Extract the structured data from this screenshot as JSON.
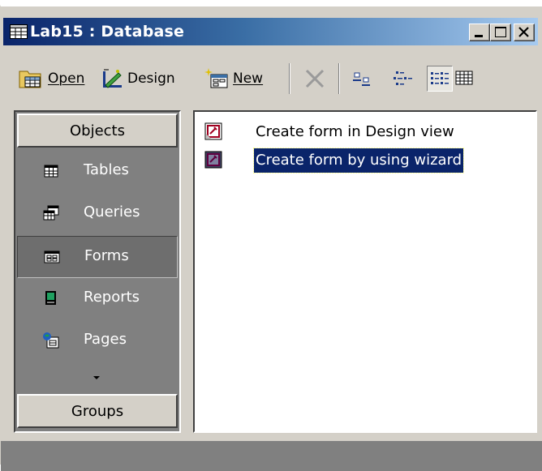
{
  "window": {
    "title": "Lab15 : Database",
    "colors": {
      "title_start": "#0a246a",
      "title_end": "#a6caf0",
      "face": "#d4d0c8",
      "selection": "#0a246a"
    }
  },
  "toolbar": {
    "open_label": "Open",
    "design_label": "Design",
    "new_label": "New",
    "icons": [
      "open-icon",
      "design-icon",
      "new-icon",
      "delete-icon",
      "large-icons-icon",
      "small-icons-icon",
      "list-icon",
      "details-icon"
    ],
    "active_view": "list"
  },
  "objects_bar": {
    "header": "Objects",
    "items": [
      {
        "label": "Tables",
        "icon": "table-icon"
      },
      {
        "label": "Queries",
        "icon": "query-icon"
      },
      {
        "label": "Forms",
        "icon": "form-icon"
      },
      {
        "label": "Reports",
        "icon": "report-icon"
      },
      {
        "label": "Pages",
        "icon": "page-icon"
      }
    ],
    "selected": "Forms",
    "groups_label": "Groups"
  },
  "forms_list": {
    "items": [
      {
        "label": "Create form in Design view",
        "icon": "design-view-shortcut-icon"
      },
      {
        "label": "Create form by using wizard",
        "icon": "wizard-shortcut-icon"
      }
    ],
    "selected": "Create form by using wizard"
  }
}
